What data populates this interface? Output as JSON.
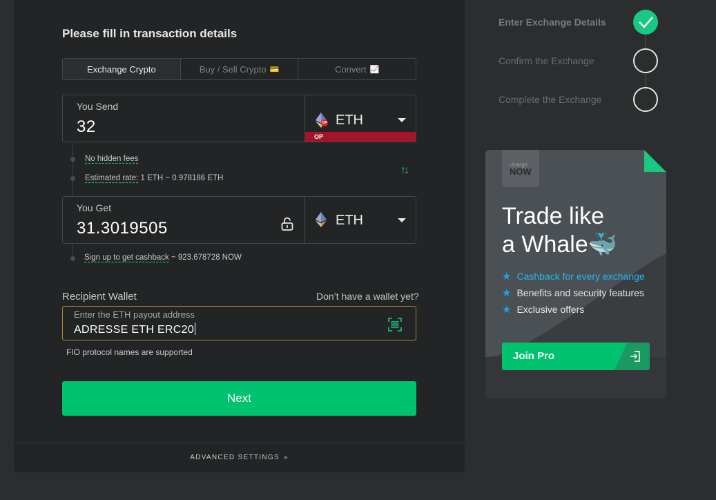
{
  "form": {
    "title": "Please fill in transaction details",
    "tabs": [
      {
        "label": "Exchange Crypto",
        "emoji": ""
      },
      {
        "label": "Buy / Sell Crypto",
        "emoji": "💳"
      },
      {
        "label": "Convert",
        "emoji": "📈"
      }
    ],
    "send": {
      "label": "You Send",
      "value": "32",
      "currency": "ETH",
      "network": "OP",
      "icon": "eth-icon"
    },
    "info": {
      "no_fees": "No hidden fees",
      "rate_label": "Estimated rate:",
      "rate_value": " 1 ETH ~ 0.978186 ETH"
    },
    "get": {
      "label": "You Get",
      "value": "31.3019505",
      "currency": "ETH",
      "icon": "eth-icon"
    },
    "cashback": {
      "link": "Sign up to get cashback",
      "value": " ~ 923.678728 NOW"
    },
    "wallet": {
      "label": "Recipient Wallet",
      "no_wallet": "Don’t have a wallet yet?",
      "placeholder": "Enter the ETH payout address",
      "value": "ADRESSE ETH  ERC20",
      "fio_note": "FIO protocol names are supported"
    },
    "next_label": "Next",
    "advanced_label": "ADVANCED SETTINGS"
  },
  "steps": [
    {
      "label": "Enter Exchange Details",
      "status": "done"
    },
    {
      "label": "Confirm the Exchange",
      "status": "pending"
    },
    {
      "label": "Complete the Exchange",
      "status": "pending"
    }
  ],
  "promo": {
    "logo_top": "change",
    "logo_bottom": "NOW",
    "title_line1": "Trade like",
    "title_line2": "a Whale",
    "title_emoji": "🐳",
    "features": [
      "Cashback for every exchange",
      "Benefits and security features",
      "Exclusive offers"
    ],
    "button": "Join Pro"
  },
  "colors": {
    "accent": "#00c26f",
    "network_badge": "#a5142a",
    "promo_highlight": "#25b7f0"
  }
}
